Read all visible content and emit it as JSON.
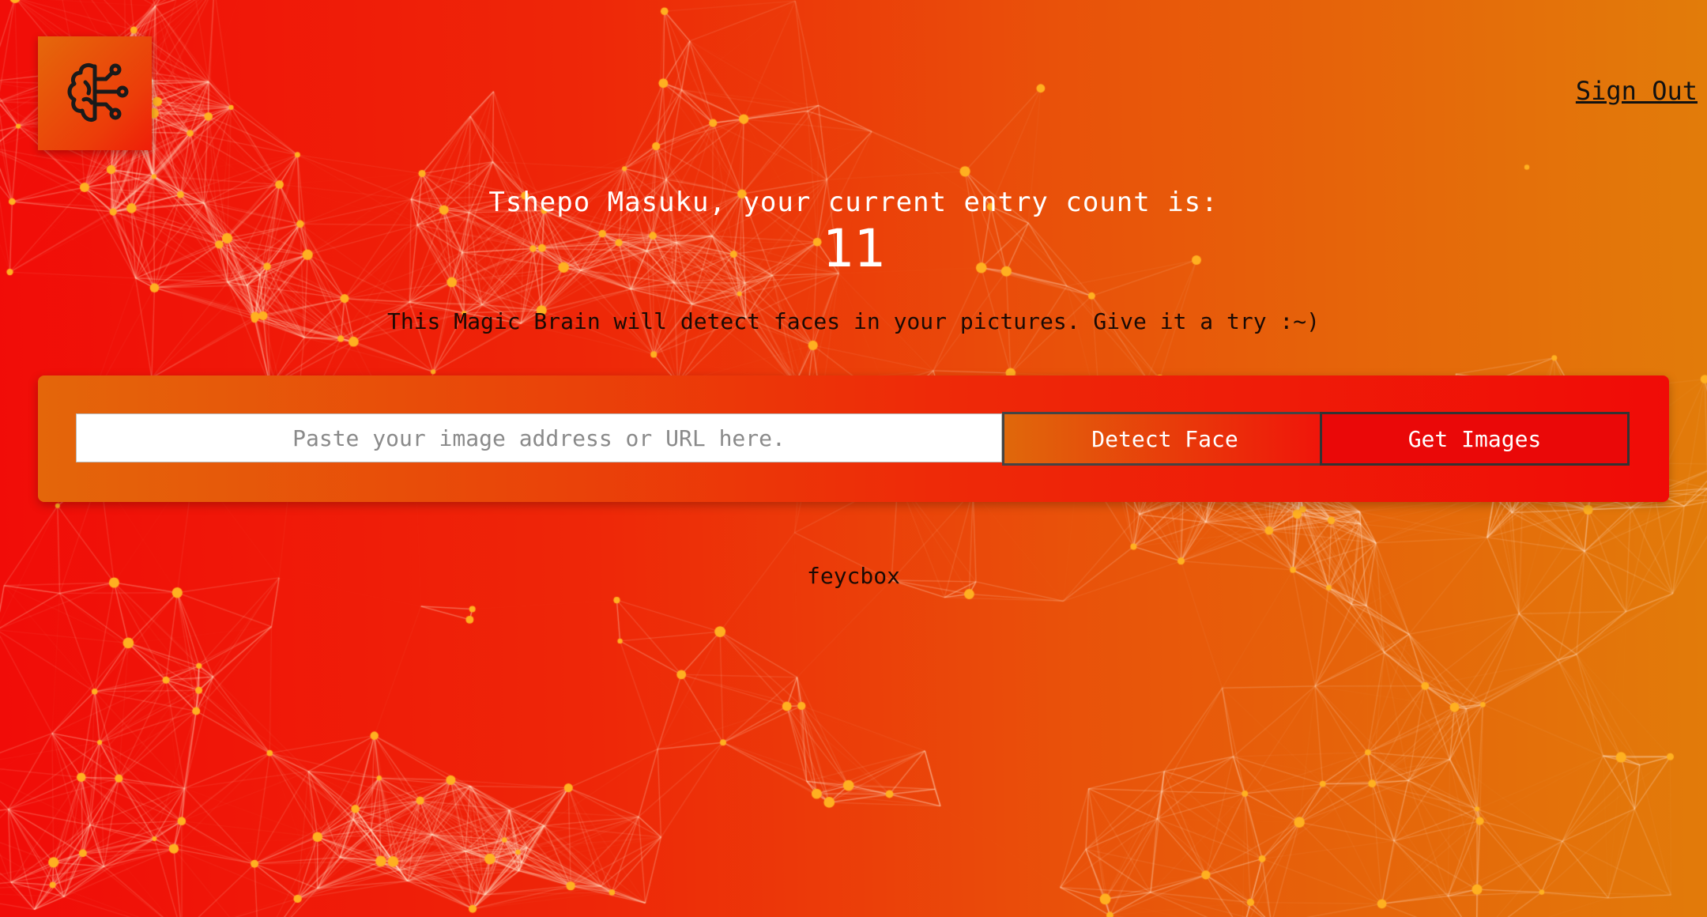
{
  "header": {
    "logo_icon": "brain-circuit-icon",
    "sign_out_label": "Sign Out"
  },
  "rank": {
    "label": "Tshepo Masuku, your current entry count is:",
    "count": "11"
  },
  "intro": {
    "text": "This Magic Brain will detect faces in your pictures. Give it a try :~)"
  },
  "form": {
    "url_placeholder": "Paste your image address or URL here.",
    "url_value": "",
    "detect_label": "Detect Face",
    "get_images_label": "Get Images"
  },
  "footer": {
    "text": "feycbox"
  },
  "colors": {
    "accent_red": "#f00b07",
    "accent_orange": "#e27c0a",
    "particle_color": "#ffb020"
  }
}
